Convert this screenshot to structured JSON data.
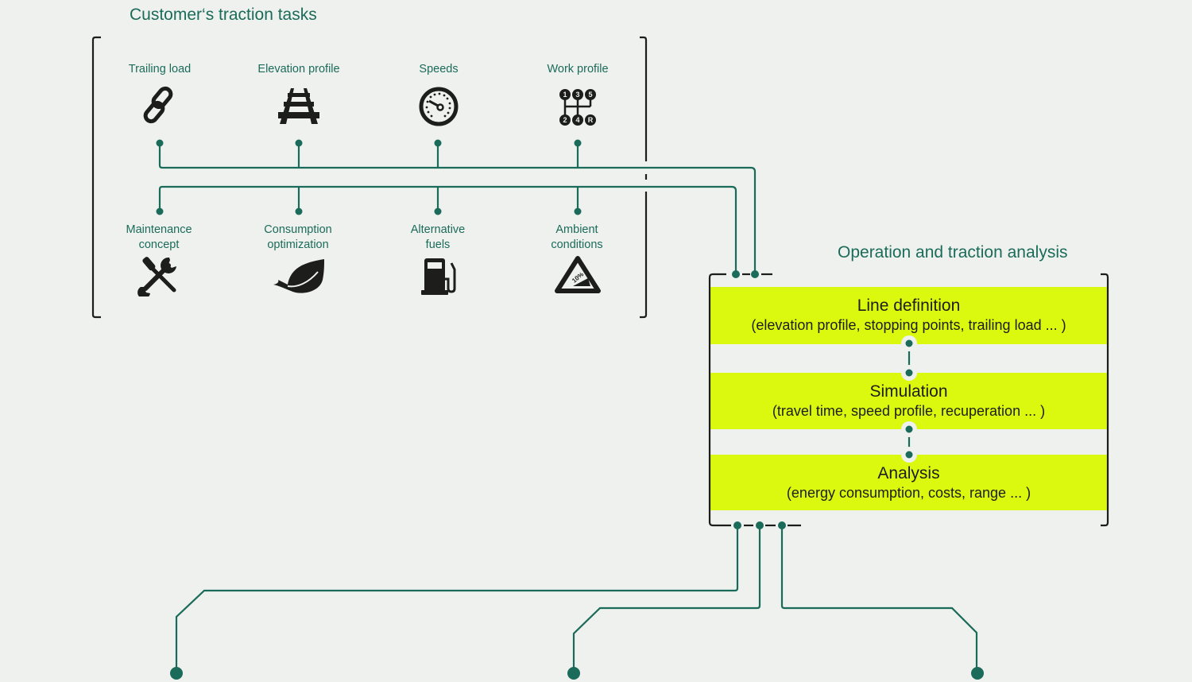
{
  "colors": {
    "accent": "#1b6b5a",
    "highlight": "#dbf80f",
    "ink": "#1d1d1b",
    "background": "#eff1ee"
  },
  "customer_section": {
    "title": "Customer‘s traction tasks",
    "top_row": [
      {
        "label": "Trailing load",
        "icon": "chain-link-icon"
      },
      {
        "label": "Elevation profile",
        "icon": "railway-track-icon"
      },
      {
        "label": "Speeds",
        "icon": "speedometer-icon"
      },
      {
        "label": "Work profile",
        "icon": "gear-shift-icon"
      }
    ],
    "bottom_row": [
      {
        "label": "Maintenance concept",
        "line1": "Maintenance",
        "line2": "concept",
        "icon": "tools-icon"
      },
      {
        "label": "Consumption optimization",
        "line1": "Consumption",
        "line2": "optimization",
        "icon": "leaf-icon"
      },
      {
        "label": "Alternative fuels",
        "line1": "Alternative",
        "line2": "fuels",
        "icon": "fuel-pump-icon"
      },
      {
        "label": "Ambient conditions",
        "line1": "Ambient",
        "line2": "conditions",
        "icon": "gradient-sign-icon"
      }
    ],
    "gear_labels": [
      "1",
      "3",
      "5",
      "2",
      "4",
      "R"
    ],
    "gradient_label": "10%"
  },
  "analysis_section": {
    "title": "Operation and traction analysis",
    "steps": [
      {
        "heading": "Line definition",
        "detail": "(elevation profile, stopping points, trailing load ... )"
      },
      {
        "heading": "Simulation",
        "detail": "(travel time, speed profile, recuperation ... )"
      },
      {
        "heading": "Analysis",
        "detail": "(energy consumption, costs, range ... )"
      }
    ]
  }
}
